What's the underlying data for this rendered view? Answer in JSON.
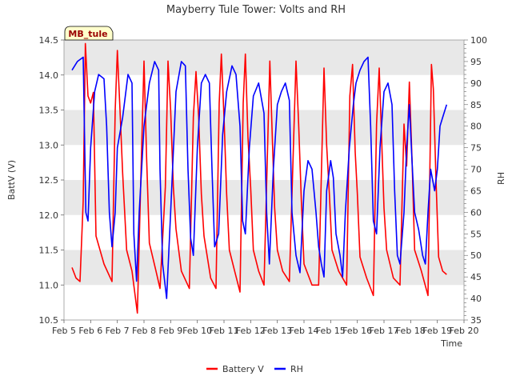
{
  "chart_data": {
    "type": "line",
    "title": "Mayberry Tule Tower: Volts and RH",
    "xlabel": "Time",
    "ylabel_left": "BattV (V)",
    "ylabel_right": "RH",
    "site_label": "MB_tule",
    "x_ticks": [
      "Feb 5",
      "Feb 6",
      "Feb 7",
      "Feb 8",
      "Feb 9",
      "Feb 10",
      "Feb 11",
      "Feb 12",
      "Feb 13",
      "Feb 14",
      "Feb 15",
      "Feb 16",
      "Feb 17",
      "Feb 18",
      "Feb 19",
      "Feb 20"
    ],
    "x_range_days": [
      5,
      20
    ],
    "y_left_range": [
      10.5,
      14.5
    ],
    "y_left_ticks": [
      "10.5",
      "11.0",
      "11.5",
      "12.0",
      "12.5",
      "13.0",
      "13.5",
      "14.0",
      "14.5"
    ],
    "y_right_range": [
      35,
      100
    ],
    "y_right_ticks": [
      "35",
      "40",
      "45",
      "50",
      "55",
      "60",
      "65",
      "70",
      "75",
      "80",
      "85",
      "90",
      "95",
      "100"
    ],
    "legend": [
      "Battery V",
      "RH"
    ],
    "legend_placement": "bottom-center",
    "grid": "alternating horizontal bands",
    "colors": {
      "battery": "#ff0000",
      "rh": "#0000ff",
      "band": "#e8e8e8"
    },
    "series": [
      {
        "name": "Battery V",
        "axis": "left",
        "points": [
          [
            5.3,
            11.25
          ],
          [
            5.45,
            11.1
          ],
          [
            5.6,
            11.05
          ],
          [
            5.72,
            12.2
          ],
          [
            5.8,
            14.45
          ],
          [
            5.9,
            13.7
          ],
          [
            6.0,
            13.6
          ],
          [
            6.1,
            13.75
          ],
          [
            6.2,
            11.7
          ],
          [
            6.5,
            11.3
          ],
          [
            6.8,
            11.05
          ],
          [
            6.92,
            13.5
          ],
          [
            7.0,
            14.35
          ],
          [
            7.1,
            13.5
          ],
          [
            7.2,
            12.6
          ],
          [
            7.35,
            11.5
          ],
          [
            7.55,
            11.2
          ],
          [
            7.75,
            10.6
          ],
          [
            7.9,
            12.8
          ],
          [
            8.0,
            14.2
          ],
          [
            8.1,
            12.8
          ],
          [
            8.2,
            11.6
          ],
          [
            8.45,
            11.2
          ],
          [
            8.6,
            10.95
          ],
          [
            8.8,
            12.4
          ],
          [
            8.9,
            14.2
          ],
          [
            9.0,
            13.5
          ],
          [
            9.1,
            12.4
          ],
          [
            9.2,
            11.8
          ],
          [
            9.4,
            11.2
          ],
          [
            9.7,
            10.95
          ],
          [
            9.85,
            13.4
          ],
          [
            9.95,
            14.05
          ],
          [
            10.05,
            13.4
          ],
          [
            10.15,
            12.3
          ],
          [
            10.25,
            11.7
          ],
          [
            10.5,
            11.1
          ],
          [
            10.7,
            10.95
          ],
          [
            10.82,
            13.6
          ],
          [
            10.9,
            14.3
          ],
          [
            11.0,
            13.4
          ],
          [
            11.1,
            12.3
          ],
          [
            11.2,
            11.5
          ],
          [
            11.4,
            11.2
          ],
          [
            11.6,
            10.9
          ],
          [
            11.72,
            13.6
          ],
          [
            11.8,
            14.3
          ],
          [
            11.9,
            13.1
          ],
          [
            12.0,
            12.4
          ],
          [
            12.1,
            11.5
          ],
          [
            12.3,
            11.2
          ],
          [
            12.5,
            11.0
          ],
          [
            12.72,
            14.2
          ],
          [
            12.82,
            13.0
          ],
          [
            12.9,
            12.1
          ],
          [
            13.0,
            11.5
          ],
          [
            13.2,
            11.2
          ],
          [
            13.45,
            11.05
          ],
          [
            13.7,
            14.2
          ],
          [
            13.8,
            13.3
          ],
          [
            13.9,
            12.2
          ],
          [
            14.0,
            11.3
          ],
          [
            14.3,
            11.0
          ],
          [
            14.55,
            11.0
          ],
          [
            14.75,
            14.1
          ],
          [
            14.85,
            13.0
          ],
          [
            14.95,
            12.3
          ],
          [
            15.05,
            11.5
          ],
          [
            15.3,
            11.2
          ],
          [
            15.6,
            11.0
          ],
          [
            15.72,
            13.7
          ],
          [
            15.82,
            14.15
          ],
          [
            15.92,
            12.9
          ],
          [
            16.0,
            12.3
          ],
          [
            16.1,
            11.4
          ],
          [
            16.35,
            11.1
          ],
          [
            16.6,
            10.85
          ],
          [
            16.72,
            13.3
          ],
          [
            16.82,
            14.1
          ],
          [
            16.92,
            13.0
          ],
          [
            17.0,
            12.1
          ],
          [
            17.1,
            11.5
          ],
          [
            17.35,
            11.1
          ],
          [
            17.6,
            11.0
          ],
          [
            17.75,
            13.3
          ],
          [
            17.85,
            12.7
          ],
          [
            17.95,
            13.9
          ],
          [
            18.05,
            12.8
          ],
          [
            18.15,
            11.5
          ],
          [
            18.4,
            11.2
          ],
          [
            18.65,
            10.85
          ],
          [
            18.78,
            14.15
          ],
          [
            18.85,
            13.8
          ],
          [
            18.95,
            12.5
          ],
          [
            19.05,
            11.4
          ],
          [
            19.2,
            11.2
          ],
          [
            19.35,
            11.15
          ]
        ]
      },
      {
        "name": "RH",
        "axis": "right",
        "points": [
          [
            5.3,
            93
          ],
          [
            5.5,
            95
          ],
          [
            5.72,
            96
          ],
          [
            5.82,
            60
          ],
          [
            5.9,
            58
          ],
          [
            6.0,
            75
          ],
          [
            6.15,
            88
          ],
          [
            6.3,
            92
          ],
          [
            6.5,
            91
          ],
          [
            6.6,
            80
          ],
          [
            6.7,
            60
          ],
          [
            6.8,
            52
          ],
          [
            6.92,
            60
          ],
          [
            7.0,
            75
          ],
          [
            7.2,
            82
          ],
          [
            7.4,
            92
          ],
          [
            7.55,
            90
          ],
          [
            7.62,
            55
          ],
          [
            7.72,
            44
          ],
          [
            7.82,
            60
          ],
          [
            8.0,
            80
          ],
          [
            8.2,
            90
          ],
          [
            8.4,
            95
          ],
          [
            8.55,
            93
          ],
          [
            8.6,
            70
          ],
          [
            8.7,
            48
          ],
          [
            8.85,
            40
          ],
          [
            9.0,
            60
          ],
          [
            9.2,
            88
          ],
          [
            9.4,
            95
          ],
          [
            9.55,
            94
          ],
          [
            9.65,
            70
          ],
          [
            9.75,
            54
          ],
          [
            9.85,
            50
          ],
          [
            10.0,
            75
          ],
          [
            10.15,
            90
          ],
          [
            10.3,
            92
          ],
          [
            10.45,
            90
          ],
          [
            10.55,
            70
          ],
          [
            10.65,
            52
          ],
          [
            10.8,
            55
          ],
          [
            10.95,
            78
          ],
          [
            11.1,
            88
          ],
          [
            11.3,
            94
          ],
          [
            11.45,
            92
          ],
          [
            11.6,
            80
          ],
          [
            11.7,
            58
          ],
          [
            11.8,
            55
          ],
          [
            11.95,
            75
          ],
          [
            12.1,
            87
          ],
          [
            12.3,
            90
          ],
          [
            12.5,
            83
          ],
          [
            12.6,
            60
          ],
          [
            12.7,
            48
          ],
          [
            12.85,
            70
          ],
          [
            13.0,
            85
          ],
          [
            13.15,
            88
          ],
          [
            13.3,
            90
          ],
          [
            13.45,
            86
          ],
          [
            13.55,
            60
          ],
          [
            13.7,
            50
          ],
          [
            13.85,
            46
          ],
          [
            14.0,
            65
          ],
          [
            14.15,
            72
          ],
          [
            14.3,
            70
          ],
          [
            14.45,
            60
          ],
          [
            14.55,
            52
          ],
          [
            14.65,
            48
          ],
          [
            14.75,
            45
          ],
          [
            14.85,
            65
          ],
          [
            15.0,
            72
          ],
          [
            15.1,
            68
          ],
          [
            15.2,
            55
          ],
          [
            15.35,
            50
          ],
          [
            15.45,
            45
          ],
          [
            15.55,
            60
          ],
          [
            15.7,
            75
          ],
          [
            15.85,
            85
          ],
          [
            15.95,
            90
          ],
          [
            16.1,
            93
          ],
          [
            16.25,
            95
          ],
          [
            16.4,
            96
          ],
          [
            16.5,
            80
          ],
          [
            16.6,
            58
          ],
          [
            16.72,
            55
          ],
          [
            16.85,
            75
          ],
          [
            17.0,
            88
          ],
          [
            17.15,
            90
          ],
          [
            17.3,
            85
          ],
          [
            17.4,
            65
          ],
          [
            17.5,
            50
          ],
          [
            17.6,
            48
          ],
          [
            17.75,
            60
          ],
          [
            17.85,
            75
          ],
          [
            17.95,
            85
          ],
          [
            18.05,
            72
          ],
          [
            18.15,
            60
          ],
          [
            18.3,
            56
          ],
          [
            18.45,
            50
          ],
          [
            18.55,
            48
          ],
          [
            18.65,
            60
          ],
          [
            18.75,
            70
          ],
          [
            18.9,
            65
          ],
          [
            19.0,
            70
          ],
          [
            19.1,
            80
          ],
          [
            19.2,
            82
          ],
          [
            19.35,
            85
          ]
        ]
      }
    ]
  }
}
